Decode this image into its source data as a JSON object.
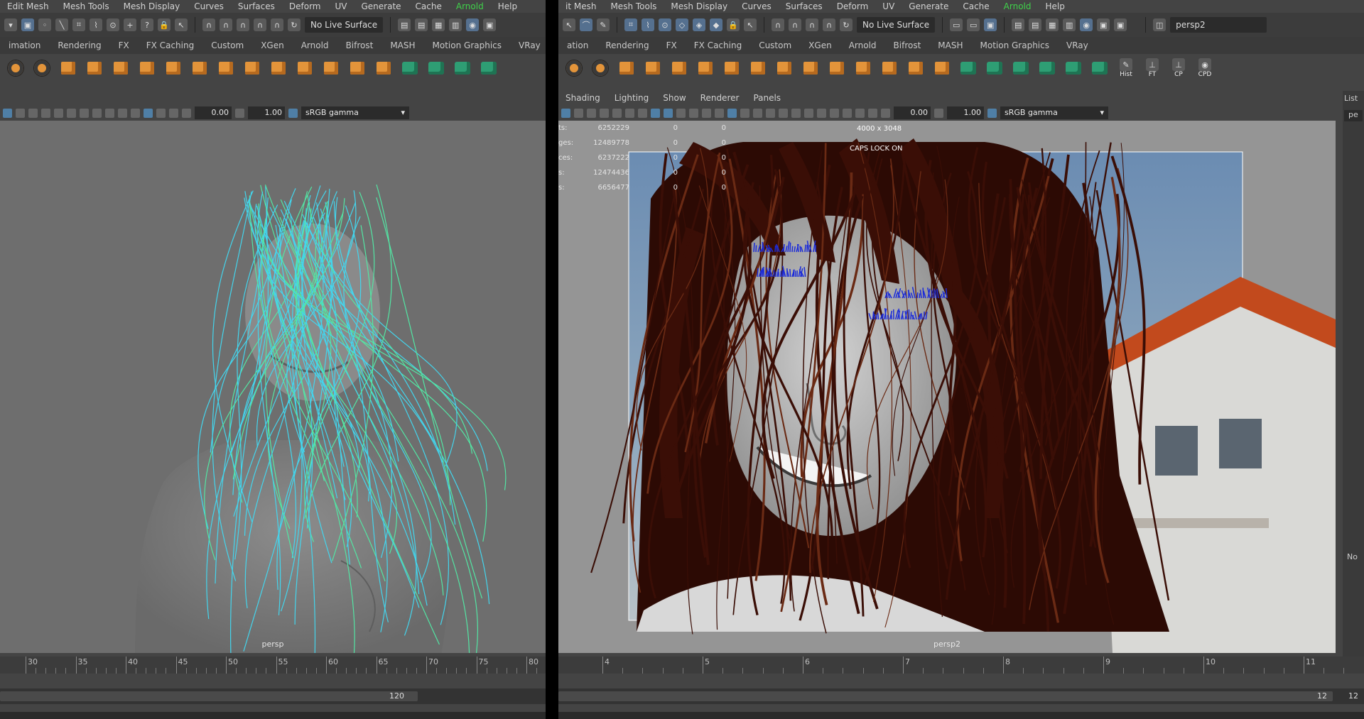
{
  "menus": {
    "left": [
      "Edit Mesh",
      "Mesh Tools",
      "Mesh Display",
      "Curves",
      "Surfaces",
      "Deform",
      "UV",
      "Generate",
      "Cache",
      "Arnold",
      "Help"
    ],
    "right": [
      "it Mesh",
      "Mesh Tools",
      "Mesh Display",
      "Curves",
      "Surfaces",
      "Deform",
      "UV",
      "Generate",
      "Cache",
      "Arnold",
      "Help"
    ]
  },
  "status": {
    "live_surface": "No Live Surface",
    "camera_field": "persp2"
  },
  "shelf_tabs": {
    "left": [
      "imation",
      "Rendering",
      "FX",
      "FX Caching",
      "Custom",
      "XGen",
      "Arnold",
      "Bifrost",
      "MASH",
      "Motion Graphics",
      "VRay"
    ],
    "right": [
      "ation",
      "Rendering",
      "FX",
      "FX Caching",
      "Custom",
      "XGen",
      "Arnold",
      "Bifrost",
      "MASH",
      "Motion Graphics",
      "VRay"
    ]
  },
  "shelf_labels": [
    "Hist",
    "FT",
    "CP",
    "CPD"
  ],
  "panel_menu": [
    "Shading",
    "Lighting",
    "Show",
    "Renderer",
    "Panels"
  ],
  "viewport_toolbar": {
    "exposure": "0.00",
    "gamma_value": "1.00",
    "colorspace": "sRGB gamma"
  },
  "viewports": {
    "left": {
      "camera": "persp"
    },
    "right": {
      "camera": "persp2",
      "resolution": "4000 x 3048",
      "caps_lock": "CAPS LOCK ON"
    }
  },
  "hud_stats": [
    {
      "label": "ts:",
      "v1": "6252229",
      "v2": "0",
      "v3": "0"
    },
    {
      "label": "ges:",
      "v1": "12489778",
      "v2": "0",
      "v3": "0"
    },
    {
      "label": "ces:",
      "v1": "6237222",
      "v2": "0",
      "v3": "0"
    },
    {
      "label": "s:",
      "v1": "12474436",
      "v2": "0",
      "v3": "0"
    },
    {
      "label": "s:",
      "v1": "6656477",
      "v2": "0",
      "v3": "0"
    }
  ],
  "timeline": {
    "left_ticks": [
      "30",
      "35",
      "40",
      "45",
      "50",
      "55",
      "60",
      "65",
      "70",
      "75",
      "80"
    ],
    "right_ticks": [
      "4",
      "5",
      "6",
      "7",
      "8",
      "9",
      "10",
      "11"
    ],
    "left_range_end": "120",
    "right_range_end": "12",
    "right_edge_value": "12"
  },
  "side_panel": {
    "list_label": "List",
    "no_label": "No",
    "field_fragment": "pe"
  },
  "colors": {
    "arnold": "#3fd24a",
    "hair_cyan": "#43d6ee",
    "hair_green": "#53e6a4",
    "hair_brown": "#3a0e06",
    "lashes_blue": "#1b2bd9"
  }
}
